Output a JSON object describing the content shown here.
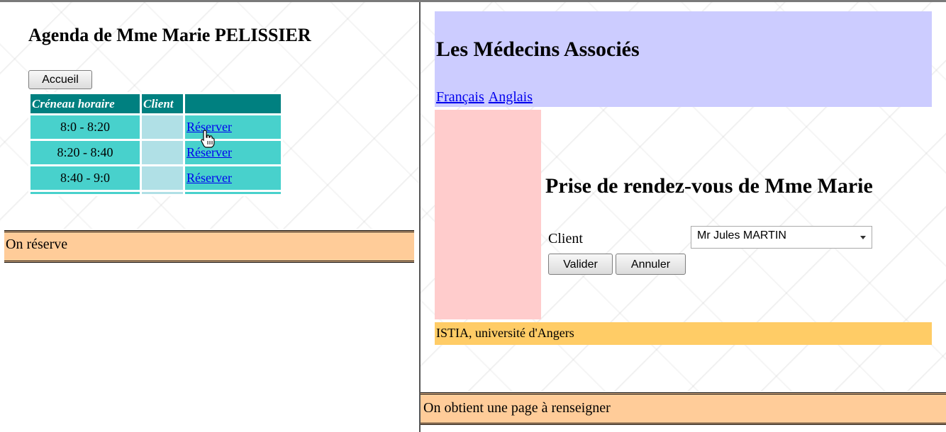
{
  "left": {
    "title": "Agenda de Mme Marie PELISSIER",
    "accueil_label": "Accueil",
    "table": {
      "headers": [
        "Créneau horaire",
        "Client",
        ""
      ],
      "rows": [
        {
          "slot": "8:0 - 8:20",
          "client": "",
          "action": "Réserver"
        },
        {
          "slot": "8:20 - 8:40",
          "client": "",
          "action": "Réserver"
        },
        {
          "slot": "8:40 - 9:0",
          "client": "",
          "action": "Réserver"
        }
      ]
    },
    "caption": "On réserve"
  },
  "right": {
    "site_title": "Les Médecins Associés",
    "languages": [
      "Français",
      "Anglais"
    ],
    "rdv_title": "Prise de rendez-vous de Mme Marie",
    "client_label": "Client",
    "client_selected": "Mr Jules MARTIN",
    "valider_label": "Valider",
    "annuler_label": "Annuler",
    "footer": "ISTIA, université d'Angers",
    "caption": "On obtient une page à renseigner"
  },
  "colors": {
    "header_band": "#ccccff",
    "left_column": "#ffcccc",
    "footer_band": "#ffcc66",
    "caption_bg": "#ffcc99",
    "table_header": "#008080",
    "table_slot": "#48d1cc",
    "table_client": "#b0e0e6"
  }
}
